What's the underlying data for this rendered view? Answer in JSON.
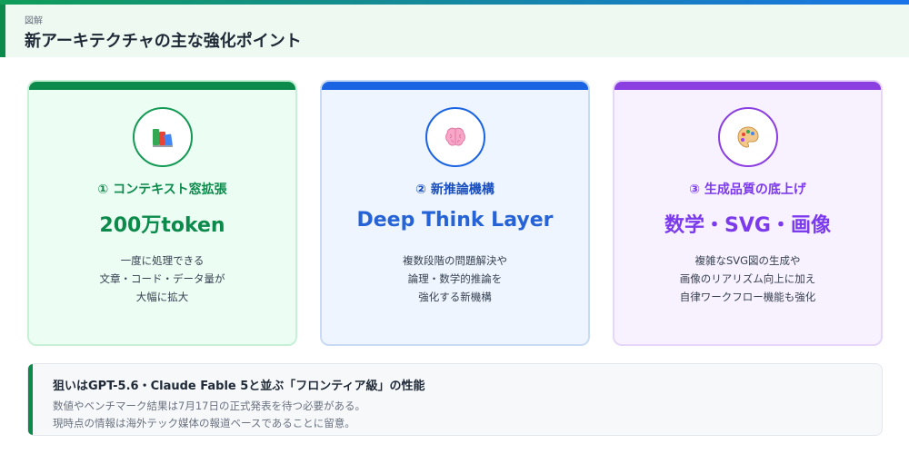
{
  "header": {
    "label": "図解",
    "title": "新アーキテクチャの主な強化ポイント"
  },
  "cards": [
    {
      "icon": "books-icon",
      "title": "① コンテキスト窓拡張",
      "highlight": "200万token",
      "lines": [
        "一度に処理できる",
        "文章・コード・データ量が",
        "大幅に拡大"
      ],
      "accent": "#0b8a4b"
    },
    {
      "icon": "brain-icon",
      "title": "② 新推論機構",
      "highlight": "Deep Think Layer",
      "lines": [
        "複数段階の問題解決や",
        "論理・数学的推論を",
        "強化する新機構"
      ],
      "accent": "#1a63e3"
    },
    {
      "icon": "palette-icon",
      "title": "③ 生成品質の底上げ",
      "highlight": "数学・SVG・画像",
      "lines": [
        "複雑なSVG図の生成や",
        "画像のリアリズム向上に加え",
        "自律ワークフロー機能も強化"
      ],
      "accent": "#8b3fe0"
    }
  ],
  "note": {
    "title": "狙いはGPT-5.6・Claude Fable 5と並ぶ「フロンティア級」の性能",
    "lines": [
      "数値やベンチマーク結果は7月17日の正式発表を待つ必要がある。",
      "現時点の情報は海外テック媒体の報道ベースであることに留意。"
    ]
  }
}
